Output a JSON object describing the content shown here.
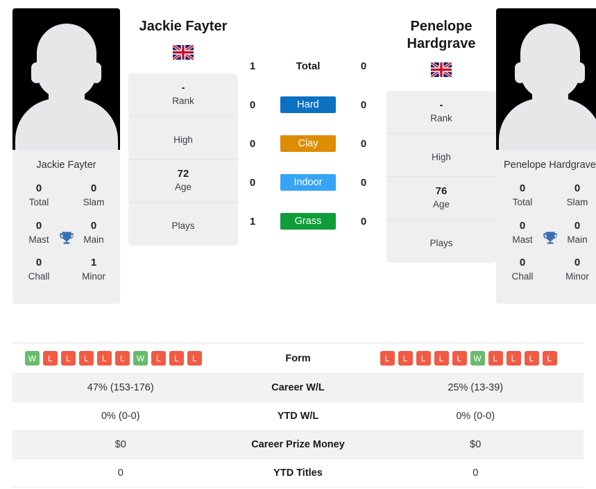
{
  "players": {
    "left": {
      "name": "Jackie Fayter",
      "photo_caption": "Jackie Fayter",
      "flag": "gb-flag-icon",
      "rank": "-",
      "rank_label": "Rank",
      "high": "",
      "high_label": "High",
      "age": "72",
      "age_label": "Age",
      "plays": "",
      "plays_label": "Plays",
      "titles": {
        "total": "0",
        "total_label": "Total",
        "slam": "0",
        "slam_label": "Slam",
        "mast": "0",
        "mast_label": "Mast",
        "main": "0",
        "main_label": "Main",
        "chall": "0",
        "chall_label": "Chall",
        "minor": "1",
        "minor_label": "Minor"
      },
      "form": [
        "W",
        "L",
        "L",
        "L",
        "L",
        "L",
        "W",
        "L",
        "L",
        "L"
      ],
      "career_wl": "47% (153-176)",
      "ytd_wl": "0% (0-0)",
      "career_prize": "$0",
      "ytd_titles": "0"
    },
    "right": {
      "name": "Penelope Hardgrave",
      "photo_caption": "Penelope Hardgrave",
      "flag": "gb-flag-icon",
      "rank": "-",
      "rank_label": "Rank",
      "high": "",
      "high_label": "High",
      "age": "76",
      "age_label": "Age",
      "plays": "",
      "plays_label": "Plays",
      "titles": {
        "total": "0",
        "total_label": "Total",
        "slam": "0",
        "slam_label": "Slam",
        "mast": "0",
        "mast_label": "Mast",
        "main": "0",
        "main_label": "Main",
        "chall": "0",
        "chall_label": "Chall",
        "minor": "0",
        "minor_label": "Minor"
      },
      "form": [
        "L",
        "L",
        "L",
        "L",
        "L",
        "W",
        "L",
        "L",
        "L",
        "L"
      ],
      "career_wl": "25% (13-39)",
      "ytd_wl": "0% (0-0)",
      "career_prize": "$0",
      "ytd_titles": "0"
    }
  },
  "surfaces": [
    {
      "label": "Total",
      "left": "1",
      "right": "0",
      "color": "transparent",
      "plain": true
    },
    {
      "label": "Hard",
      "left": "0",
      "right": "0",
      "color": "#0b71c2",
      "plain": false
    },
    {
      "label": "Clay",
      "left": "0",
      "right": "0",
      "color": "#df8c05",
      "plain": false
    },
    {
      "label": "Indoor",
      "left": "0",
      "right": "0",
      "color": "#37a4f5",
      "plain": false
    },
    {
      "label": "Grass",
      "left": "1",
      "right": "0",
      "color": "#0f9d3a",
      "plain": false
    }
  ],
  "stats_rows": [
    {
      "label": "Form",
      "key": "form",
      "type": "form"
    },
    {
      "label": "Career W/L",
      "key": "career_wl",
      "type": "text"
    },
    {
      "label": "YTD W/L",
      "key": "ytd_wl",
      "type": "text"
    },
    {
      "label": "Career Prize Money",
      "key": "career_prize",
      "type": "text"
    },
    {
      "label": "YTD Titles",
      "key": "ytd_titles",
      "type": "text"
    }
  ],
  "colors": {
    "win": "#68bb6c",
    "loss": "#f15b43",
    "trophy": "#3a6fb5",
    "card_bg": "#efefef",
    "row_alt": "#f2f2f2"
  }
}
